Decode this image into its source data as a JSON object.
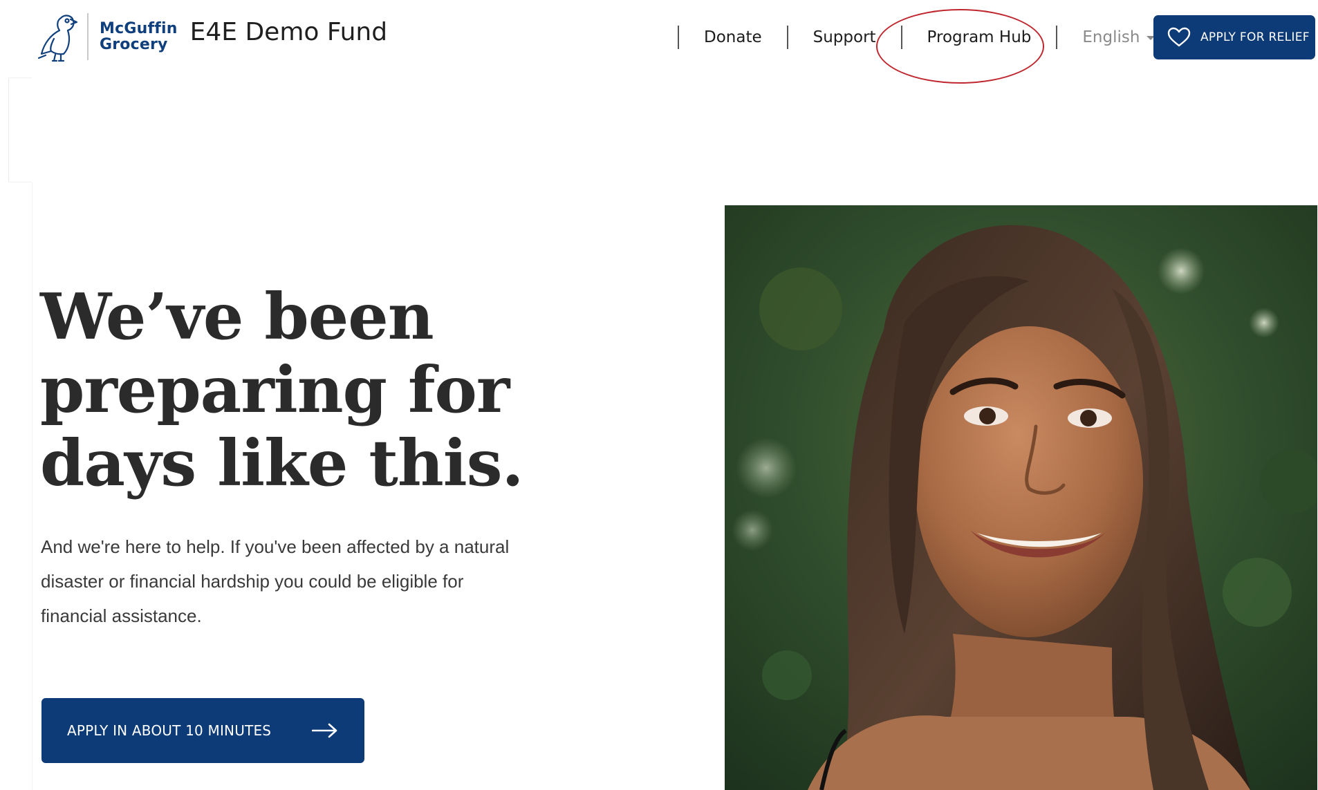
{
  "header": {
    "brand_line1": "McGuffin",
    "brand_line2": "Grocery",
    "site_title": "E4E Demo Fund",
    "nav": {
      "donate": "Donate",
      "support": "Support",
      "program_hub": "Program Hub",
      "language": "English"
    },
    "apply_relief": "APPLY FOR RELIEF"
  },
  "hero": {
    "heading_line1": "We’ve been",
    "heading_line2": "preparing for",
    "heading_line3": "days like this.",
    "body_line1": "And we're here to help. If you've been affected by a natural",
    "body_line2": "disaster or financial hardship you could be eligible for",
    "body_line3": "financial assistance.",
    "cta_label": "APPLY IN ABOUT 10 MINUTES"
  },
  "icons": {
    "logo": "puffin-logo-icon",
    "apply_relief": "heart-icon",
    "cta": "arrow-right-icon",
    "language": "caret-down-icon"
  },
  "colors": {
    "brand_navy": "#0d3b78",
    "brand_text": "#0f3f7d",
    "highlight": "#c0262d",
    "heading": "#2b2b2b"
  }
}
